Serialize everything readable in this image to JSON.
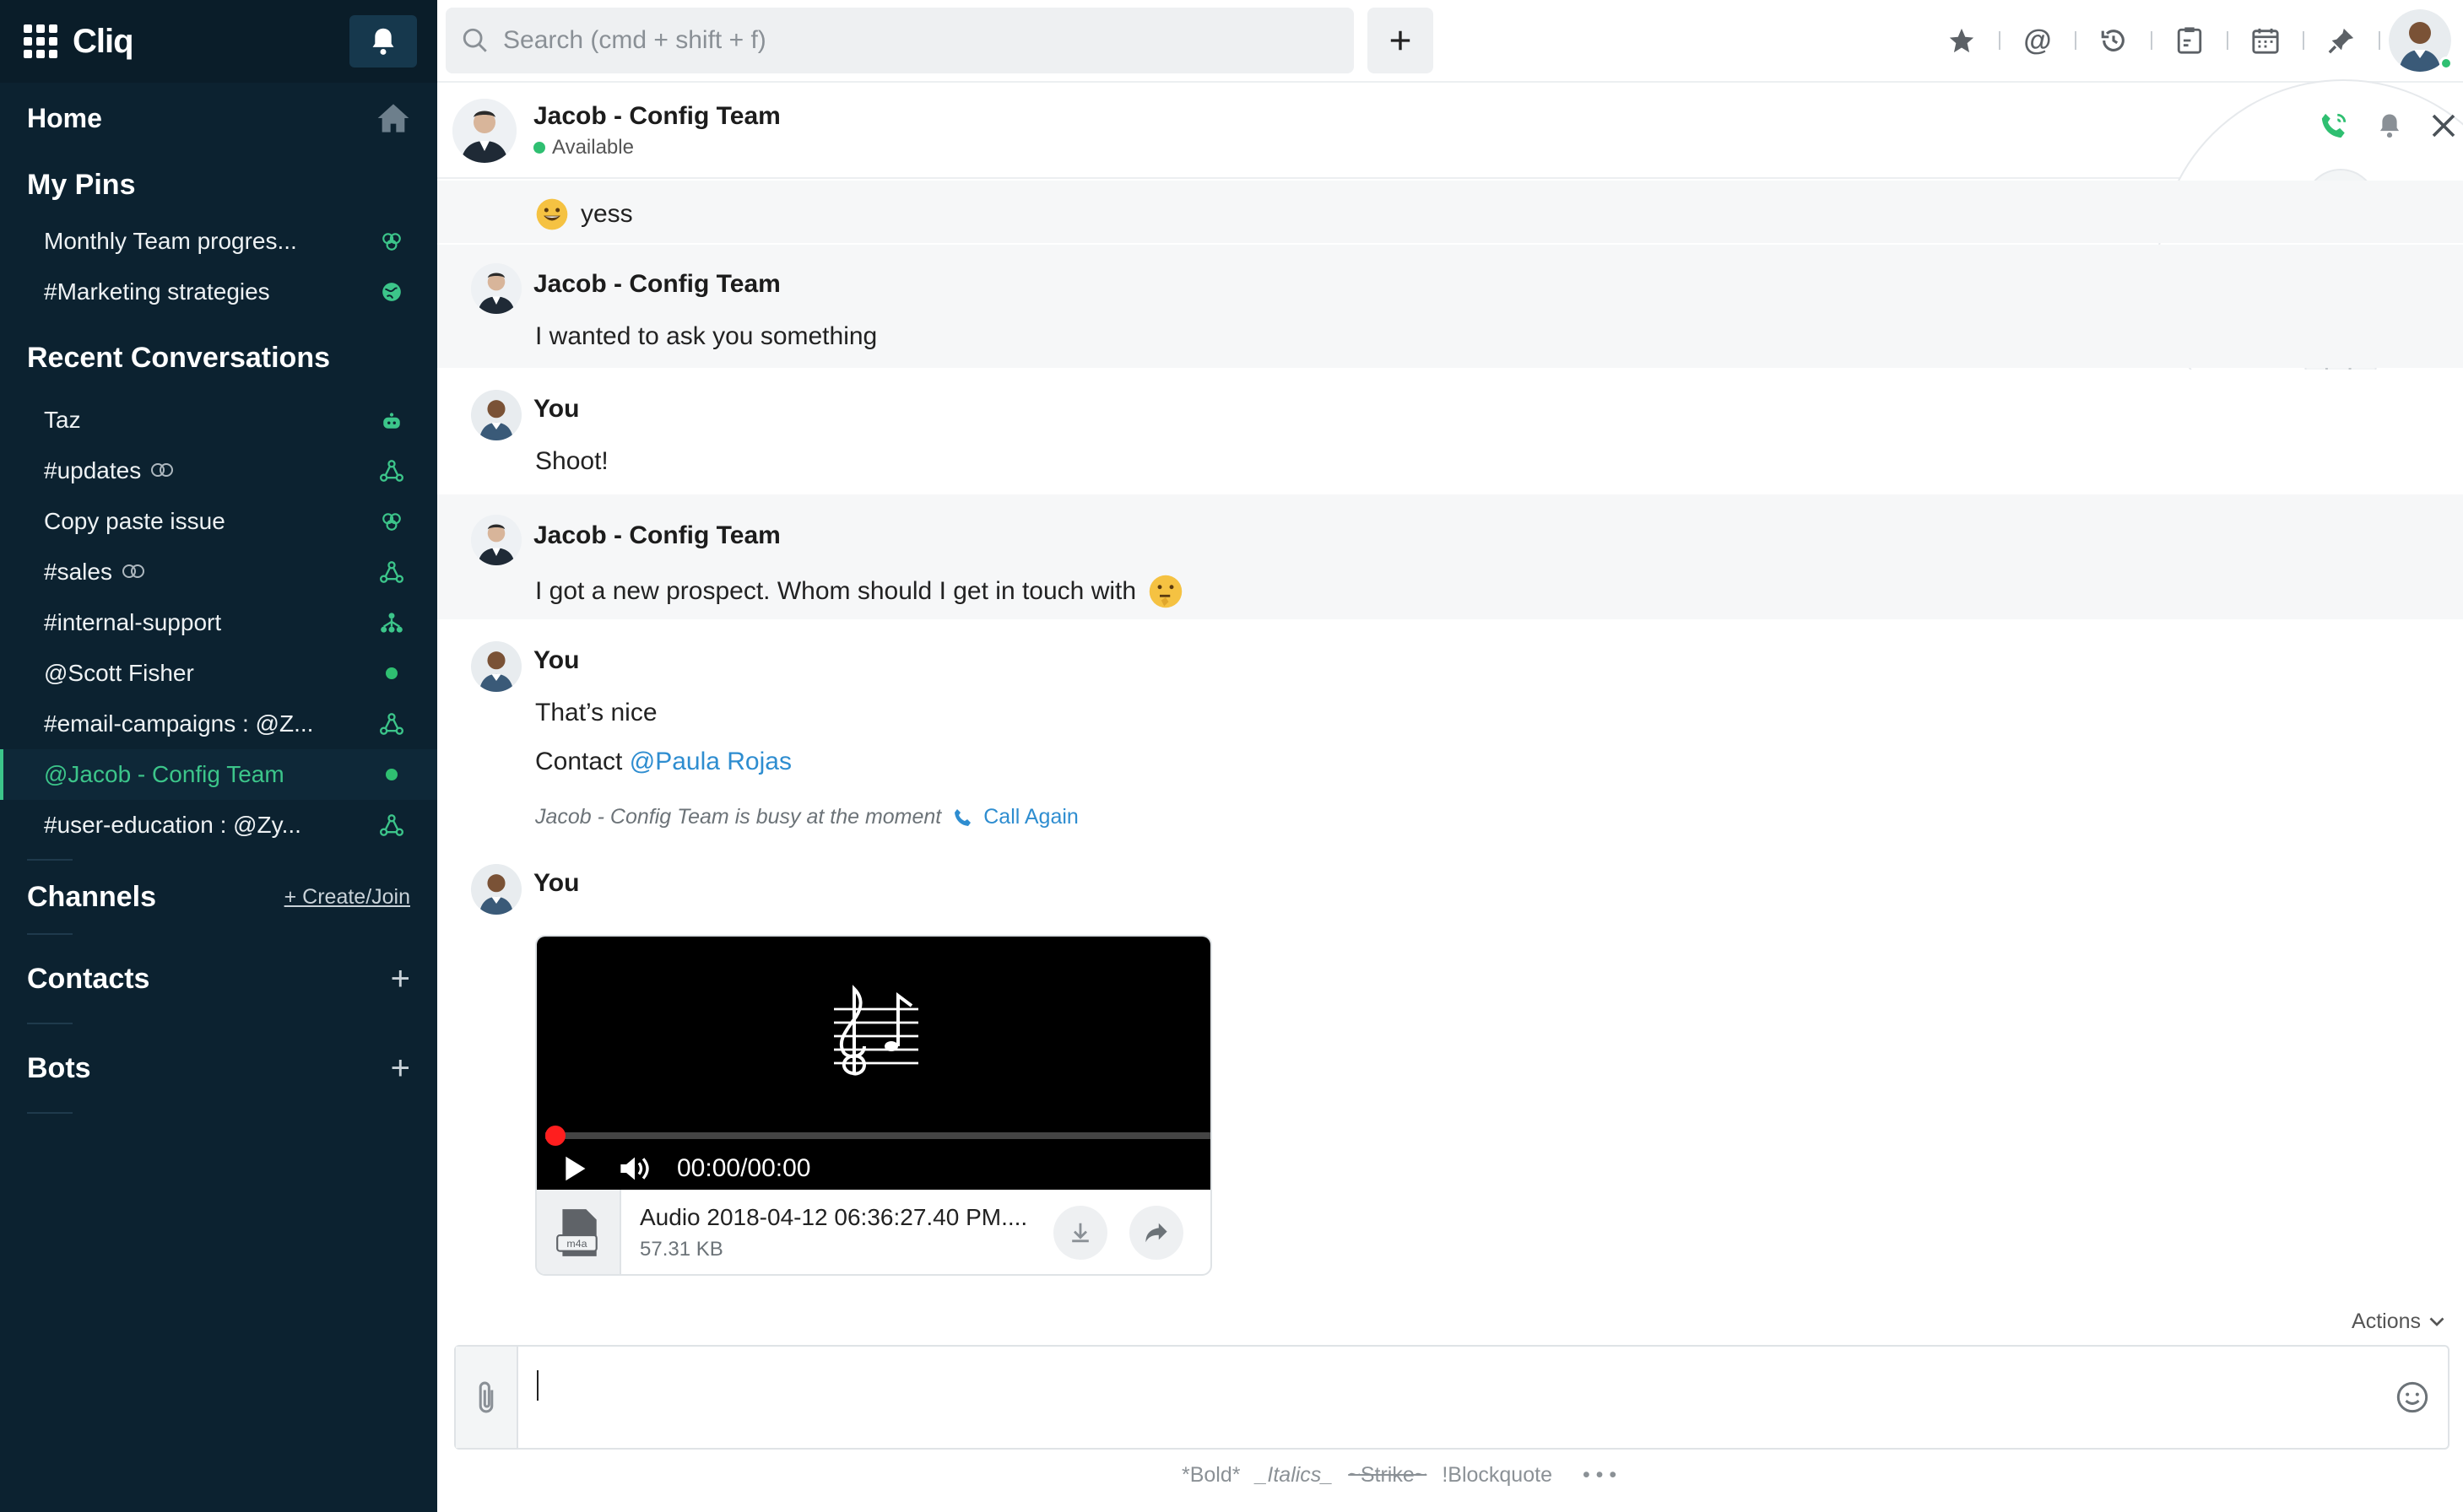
{
  "app": {
    "name": "Cliq"
  },
  "sidebar": {
    "home_label": "Home",
    "pins_title": "My Pins",
    "pins": [
      {
        "label": "Monthly Team progres...",
        "icon": "group-icon"
      },
      {
        "label": "#Marketing strategies",
        "icon": "globe-icon"
      }
    ],
    "recent_title": "Recent Conversations",
    "recent": [
      {
        "label": "Taz",
        "icon": "bot-icon"
      },
      {
        "label": "#updates",
        "icon": "channel-icon",
        "linked": true
      },
      {
        "label": "Copy paste issue",
        "icon": "group-icon"
      },
      {
        "label": "#sales",
        "icon": "channel-icon",
        "linked": true
      },
      {
        "label": "#internal-support",
        "icon": "org-channel-icon"
      },
      {
        "label": "@Scott Fisher",
        "icon": "online-dot"
      },
      {
        "label": "#email-campaigns : @Z...",
        "icon": "channel-icon"
      },
      {
        "label": "@Jacob - Config Team",
        "icon": "online-dot",
        "active": true
      },
      {
        "label": "#user-education : @Zy...",
        "icon": "channel-icon"
      }
    ],
    "channels_title": "Channels",
    "create_join": "+ Create/Join",
    "contacts_title": "Contacts",
    "bots_title": "Bots"
  },
  "search": {
    "placeholder": "Search (cmd + shift + f)"
  },
  "chat": {
    "name": "Jacob - Config Team",
    "status": "Available"
  },
  "messages": [
    {
      "sender": "",
      "text": "yess",
      "emoji": "grinning"
    },
    {
      "sender": "Jacob - Config Team",
      "text": "I wanted to ask you something"
    },
    {
      "sender": "You",
      "text": "Shoot!"
    },
    {
      "sender": "Jacob - Config Team",
      "text": "I got a new prospect. Whom should I get in touch with"
    },
    {
      "sender": "You",
      "lines": [
        "That’s nice",
        "Contact"
      ],
      "mention": "@Paula Rojas",
      "note": "Jacob - Config Team is busy at the moment",
      "call_again": "Call Again"
    },
    {
      "sender": "You",
      "attachment": {
        "time": "00:00/00:00",
        "file_name": "Audio 2018-04-12 06:36:27.40 PM....",
        "file_type": "m4a",
        "file_size": "57.31 KB",
        "progress": 0
      }
    }
  ],
  "composer": {
    "actions_label": "Actions",
    "format_hints": [
      "*Bold*",
      "_Italics_",
      "~Strike~",
      "!Blockquote",
      "• • •"
    ]
  },
  "colors": {
    "accent": "#2fbf71",
    "sidebar_bg": "#0c2230",
    "link": "#2e8dd0"
  }
}
